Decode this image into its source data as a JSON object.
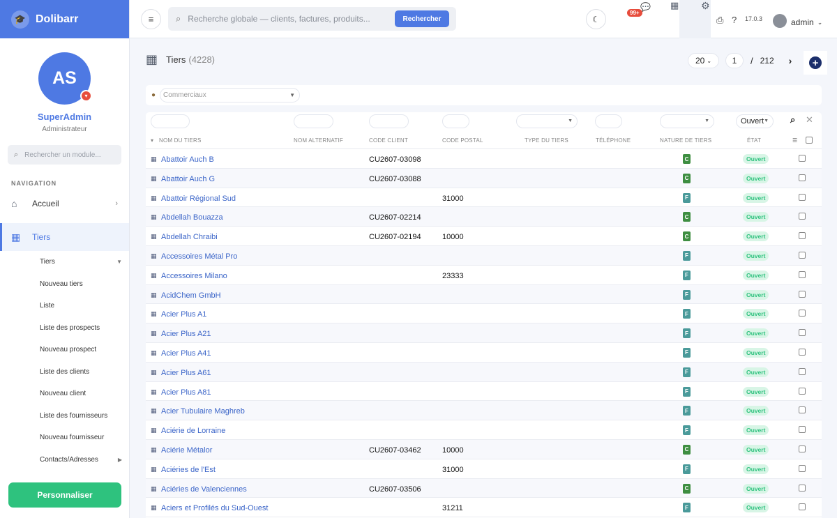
{
  "brand": {
    "name": "Dolibarr",
    "icon": "graduation-cap-icon"
  },
  "profile": {
    "initials": "AS",
    "name": "SuperAdmin",
    "role": "Administrateur"
  },
  "sidebar": {
    "search_placeholder": "Rechercher un module...",
    "nav_title": "NAVIGATION",
    "items": [
      {
        "label": "Accueil",
        "icon": "home-icon"
      },
      {
        "label": "Tiers",
        "icon": "building-icon",
        "active": true
      }
    ],
    "subitems": [
      "Tiers",
      "Nouveau tiers",
      "Liste",
      "Liste des prospects",
      "Nouveau prospect",
      "Liste des clients",
      "Nouveau client",
      "Liste des fournisseurs",
      "Nouveau fournisseur",
      "Contacts/Adresses"
    ],
    "personalize_label": "Personnaliser"
  },
  "topbar": {
    "search_placeholder": "Recherche globale — clients, factures, produits...",
    "search_button": "Rechercher",
    "notif_count": "99+",
    "version": "17.0.3",
    "user": "admin"
  },
  "page": {
    "title": "Tiers",
    "count": "(4228)",
    "limit": "20",
    "current_page": "1",
    "total_pages": "212",
    "commercial_placeholder": "Commerciaux",
    "status_filter": "Ouvert"
  },
  "columns": {
    "name": "NOM DU TIERS",
    "alt_name": "NOM ALTERNATIF",
    "client_code": "CODE CLIENT",
    "postal_code": "CODE POSTAL",
    "type": "TYPE DU TIERS",
    "phone": "TÉLÉPHONE",
    "nature": "NATURE DE TIERS",
    "status": "ÉTAT"
  },
  "rows": [
    {
      "name": "Abattoir Auch B",
      "client_code": "CU2607-03098",
      "postal_code": "",
      "nature": "C",
      "status": "Ouvert"
    },
    {
      "name": "Abattoir Auch G",
      "client_code": "CU2607-03088",
      "postal_code": "",
      "nature": "C",
      "status": "Ouvert"
    },
    {
      "name": "Abattoir Régional Sud",
      "client_code": "",
      "postal_code": "31000",
      "nature": "F",
      "status": "Ouvert"
    },
    {
      "name": "Abdellah Bouazza",
      "client_code": "CU2607-02214",
      "postal_code": "",
      "nature": "C",
      "status": "Ouvert"
    },
    {
      "name": "Abdellah Chraibi",
      "client_code": "CU2607-02194",
      "postal_code": "10000",
      "nature": "C",
      "status": "Ouvert"
    },
    {
      "name": "Accessoires Métal Pro",
      "client_code": "",
      "postal_code": "",
      "nature": "F",
      "status": "Ouvert"
    },
    {
      "name": "Accessoires Milano",
      "client_code": "",
      "postal_code": "23333",
      "nature": "F",
      "status": "Ouvert"
    },
    {
      "name": "AcidChem GmbH",
      "client_code": "",
      "postal_code": "",
      "nature": "F",
      "status": "Ouvert"
    },
    {
      "name": "Acier Plus A1",
      "client_code": "",
      "postal_code": "",
      "nature": "F",
      "status": "Ouvert"
    },
    {
      "name": "Acier Plus A21",
      "client_code": "",
      "postal_code": "",
      "nature": "F",
      "status": "Ouvert"
    },
    {
      "name": "Acier Plus A41",
      "client_code": "",
      "postal_code": "",
      "nature": "F",
      "status": "Ouvert"
    },
    {
      "name": "Acier Plus A61",
      "client_code": "",
      "postal_code": "",
      "nature": "F",
      "status": "Ouvert"
    },
    {
      "name": "Acier Plus A81",
      "client_code": "",
      "postal_code": "",
      "nature": "F",
      "status": "Ouvert"
    },
    {
      "name": "Acier Tubulaire Maghreb",
      "client_code": "",
      "postal_code": "",
      "nature": "F",
      "status": "Ouvert"
    },
    {
      "name": "Aciérie de Lorraine",
      "client_code": "",
      "postal_code": "",
      "nature": "F",
      "status": "Ouvert"
    },
    {
      "name": "Aciérie Métalor",
      "client_code": "CU2607-03462",
      "postal_code": "10000",
      "nature": "C",
      "status": "Ouvert"
    },
    {
      "name": "Aciéries de l'Est",
      "client_code": "",
      "postal_code": "31000",
      "nature": "F",
      "status": "Ouvert"
    },
    {
      "name": "Aciéries de Valenciennes",
      "client_code": "CU2607-03506",
      "postal_code": "",
      "nature": "C",
      "status": "Ouvert"
    },
    {
      "name": "Aciers et Profilés du Sud-Ouest",
      "client_code": "",
      "postal_code": "31211",
      "nature": "F",
      "status": "Ouvert"
    }
  ],
  "colors": {
    "accent": "#4e79e3",
    "success": "#2ec27e",
    "client": "#3e8e41",
    "supplier": "#4a9a9a"
  }
}
